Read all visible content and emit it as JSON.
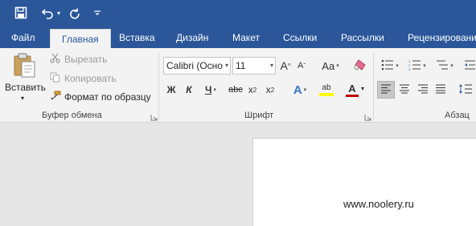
{
  "quick_access": {
    "save_icon": "save-icon",
    "undo_icon": "undo-icon",
    "undo_dropdown": "▾",
    "redo_icon": "redo-icon",
    "customize": "="
  },
  "tabs": [
    {
      "label": "Файл",
      "active": false
    },
    {
      "label": "Главная",
      "active": true
    },
    {
      "label": "Вставка",
      "active": false
    },
    {
      "label": "Дизайн",
      "active": false
    },
    {
      "label": "Макет",
      "active": false
    },
    {
      "label": "Ссылки",
      "active": false
    },
    {
      "label": "Рассылки",
      "active": false
    },
    {
      "label": "Рецензировани",
      "active": false
    }
  ],
  "clipboard": {
    "paste_label": "Вставить",
    "paste_arrow": "▾",
    "cut_label": "Вырезать",
    "copy_label": "Копировать",
    "format_painter_label": "Формат по образцу",
    "group_label": "Буфер обмена"
  },
  "font": {
    "font_name": "Calibri (Осно",
    "font_size": "11",
    "grow_label": "A",
    "shrink_label": "A",
    "case_label": "Aa",
    "bold": "Ж",
    "italic": "К",
    "underline": "Ч",
    "strike": "abc",
    "subscript": "x",
    "superscript": "x",
    "sub_mark": "2",
    "sup_mark": "2",
    "effects_label": "A",
    "highlight_label": "ab",
    "color_label": "A",
    "group_label": "Шрифт",
    "highlight_color": "#ffff00",
    "font_color": "#c00000"
  },
  "paragraph": {
    "group_label": "Абзац"
  },
  "document": {
    "watermark": "www.noolery.ru"
  },
  "colors": {
    "brand": "#2b579a",
    "ribbon_bg": "#f3f3f3",
    "doc_bg": "#e6e6e6"
  }
}
